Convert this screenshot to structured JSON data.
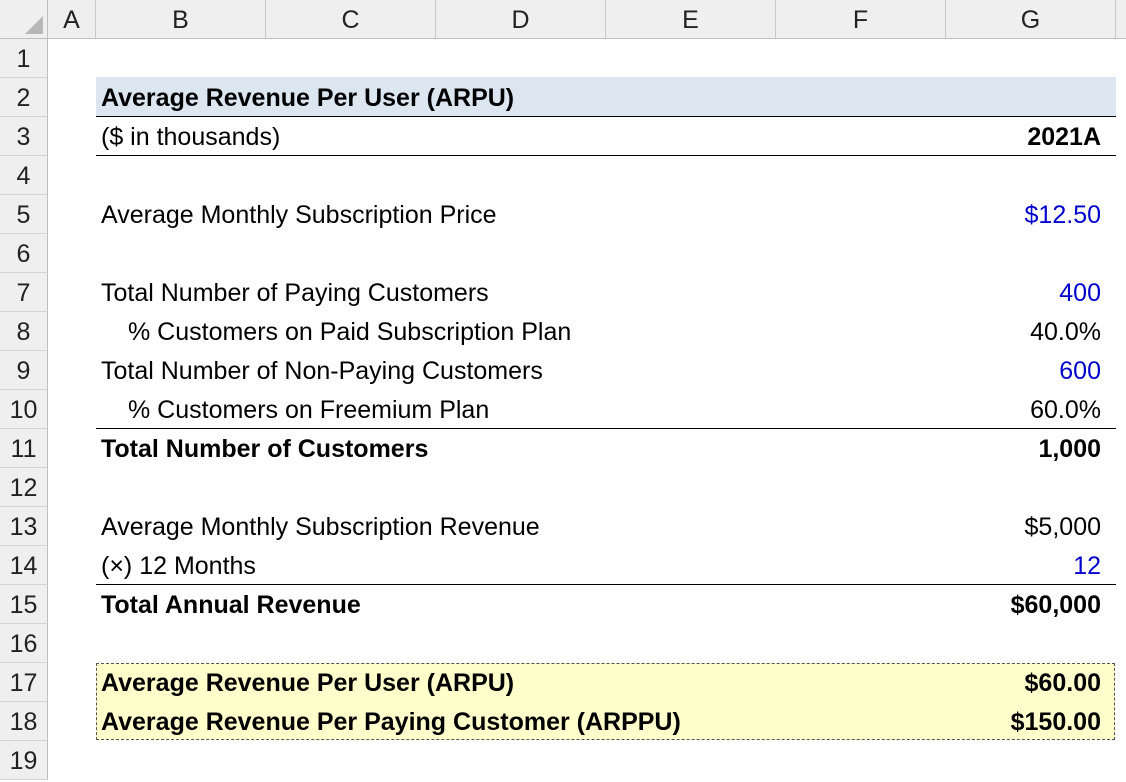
{
  "columns": [
    "A",
    "B",
    "C",
    "D",
    "E",
    "F",
    "G"
  ],
  "rows": [
    "1",
    "2",
    "3",
    "4",
    "5",
    "6",
    "7",
    "8",
    "9",
    "10",
    "11",
    "12",
    "13",
    "14",
    "15",
    "16",
    "17",
    "18",
    "19"
  ],
  "sheet": {
    "title": "Average Revenue Per User (ARPU)",
    "units": "($ in thousands)",
    "period": "2021A",
    "avg_monthly_price": {
      "label": "Average Monthly Subscription Price",
      "value": "$12.50"
    },
    "paying_customers": {
      "label": "Total Number of Paying Customers",
      "value": "400"
    },
    "pct_paid": {
      "label": "% Customers on Paid Subscription Plan",
      "value": "40.0%"
    },
    "non_paying_customers": {
      "label": "Total Number of Non-Paying Customers",
      "value": "600"
    },
    "pct_freemium": {
      "label": "% Customers on Freemium Plan",
      "value": "60.0%"
    },
    "total_customers": {
      "label": "Total Number of Customers",
      "value": "1,000"
    },
    "avg_monthly_revenue": {
      "label": "Average Monthly Subscription Revenue",
      "value": "$5,000"
    },
    "months": {
      "label": "(×) 12 Months",
      "value": "12"
    },
    "total_annual_revenue": {
      "label": "Total Annual Revenue",
      "value": "$60,000"
    },
    "arpu": {
      "label": "Average Revenue Per User (ARPU)",
      "value": "$60.00"
    },
    "arppu": {
      "label": "Average Revenue Per Paying Customer (ARPPU)",
      "value": "$150.00"
    }
  },
  "colors": {
    "input_blue": "#0000cc",
    "title_fill": "#dce6f1",
    "result_fill": "#ffffcc"
  }
}
